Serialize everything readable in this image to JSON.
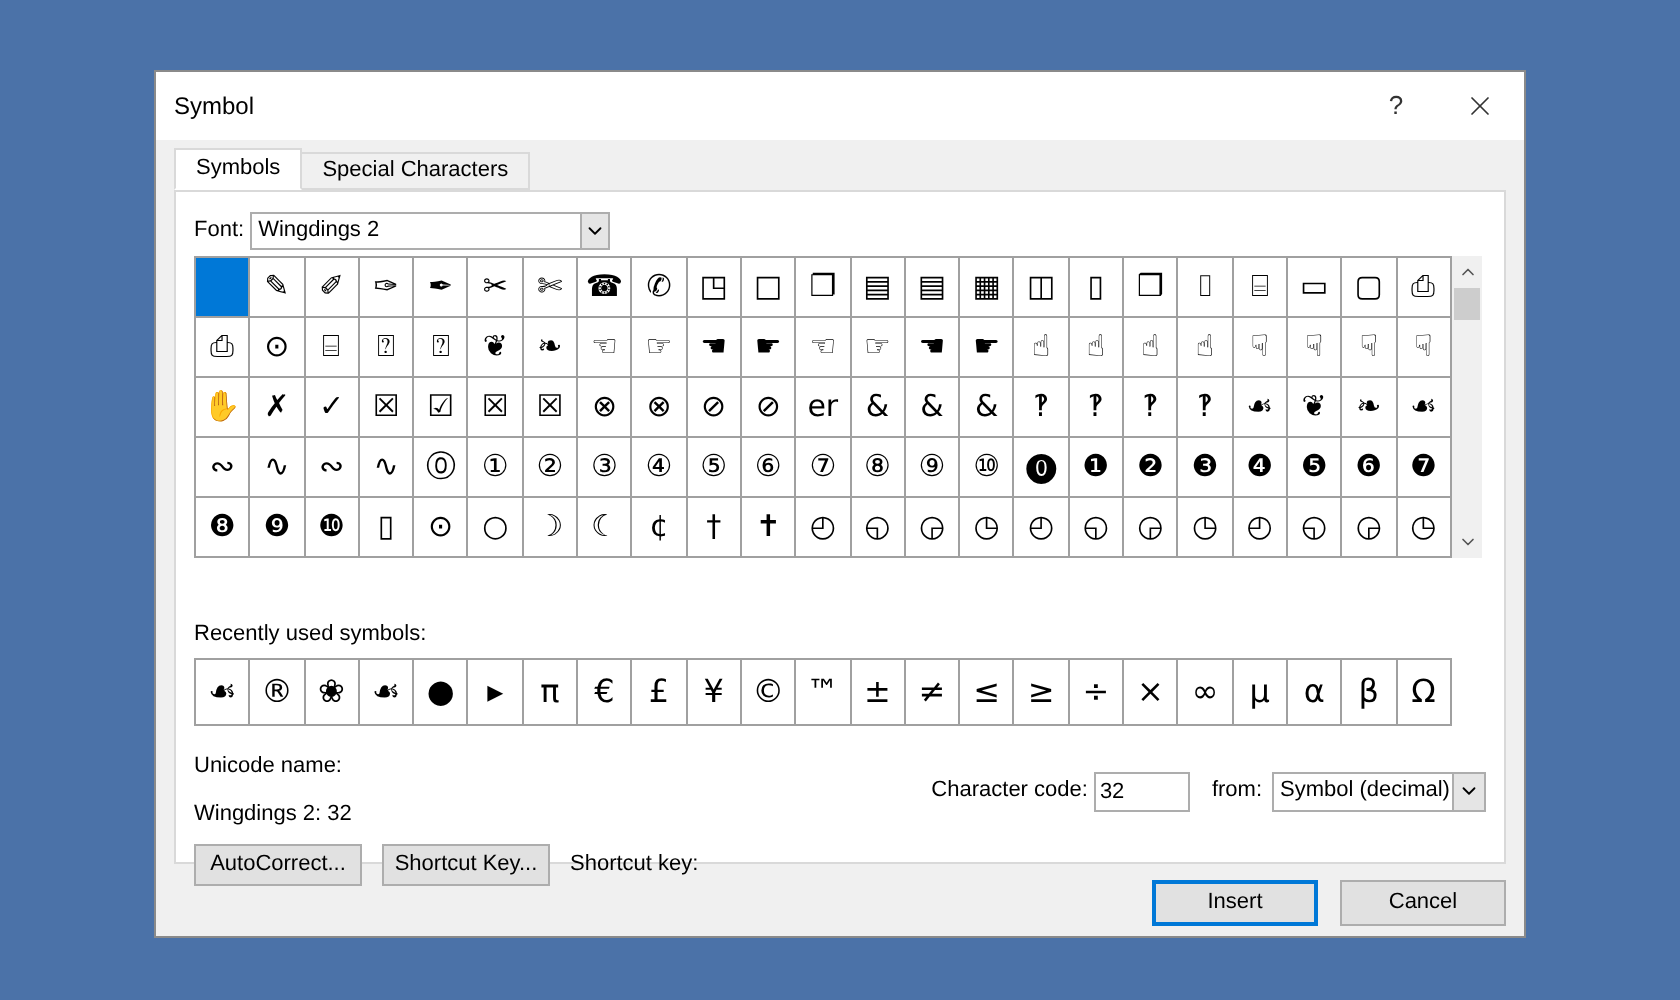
{
  "window": {
    "title": "Symbol",
    "help": "?"
  },
  "tabs": [
    {
      "label": "Symbols",
      "selected": true
    },
    {
      "label": "Special Characters",
      "selected": false
    }
  ],
  "font": {
    "label": "Font:",
    "value": "Wingdings 2"
  },
  "symbols": [
    [
      {
        "selected": true
      },
      {
        "glyph": "✎",
        "selected": false
      },
      {
        "glyph": "✐",
        "selected": false
      },
      {
        "glyph": "✑",
        "selected": false
      },
      {
        "glyph": "✒",
        "selected": false
      },
      {
        "glyph": "✂",
        "selected": false
      },
      {
        "glyph": "✄",
        "selected": false
      },
      {
        "glyph": "☎",
        "selected": false
      },
      {
        "glyph": "✆",
        "selected": false
      },
      {
        "glyph": "◳",
        "selected": false
      },
      {
        "glyph": "□",
        "selected": false
      },
      {
        "glyph": "❐",
        "selected": false
      },
      {
        "glyph": "▤",
        "selected": false
      },
      {
        "glyph": "▤",
        "selected": false
      },
      {
        "glyph": "▦",
        "selected": false
      },
      {
        "glyph": "◫",
        "selected": false
      },
      {
        "glyph": "▯",
        "selected": false
      },
      {
        "glyph": "❒",
        "selected": false
      },
      {
        "glyph": "⌷",
        "selected": false
      },
      {
        "glyph": "⌸",
        "selected": false
      },
      {
        "glyph": "▭",
        "selected": false
      },
      {
        "glyph": "▢",
        "selected": false
      },
      {
        "glyph": "⎙",
        "selected": false
      }
    ],
    [
      {
        "glyph": "⎙",
        "selected": false
      },
      {
        "glyph": "⊙",
        "selected": false
      },
      {
        "glyph": "⌸",
        "selected": false
      },
      {
        "glyph": "⍰",
        "selected": false
      },
      {
        "glyph": "⍰",
        "selected": false
      },
      {
        "glyph": "❦",
        "selected": false
      },
      {
        "glyph": "❧",
        "selected": false
      },
      {
        "glyph": "☜",
        "selected": false
      },
      {
        "glyph": "☞",
        "selected": false
      },
      {
        "glyph": "☚",
        "selected": false
      },
      {
        "glyph": "☛",
        "selected": false
      },
      {
        "glyph": "☜",
        "selected": false
      },
      {
        "glyph": "☞",
        "selected": false
      },
      {
        "glyph": "☚",
        "selected": false
      },
      {
        "glyph": "☛",
        "selected": false
      },
      {
        "glyph": "☝",
        "selected": false
      },
      {
        "glyph": "☝",
        "selected": false
      },
      {
        "glyph": "☝",
        "selected": false
      },
      {
        "glyph": "☝",
        "selected": false
      },
      {
        "glyph": "☟",
        "selected": false
      },
      {
        "glyph": "☟",
        "selected": false
      },
      {
        "glyph": "☟",
        "selected": false
      },
      {
        "glyph": "☟",
        "selected": false
      }
    ],
    [
      {
        "glyph": "✋",
        "selected": false
      },
      {
        "glyph": "✗",
        "selected": false
      },
      {
        "glyph": "✓",
        "selected": false
      },
      {
        "glyph": "☒",
        "selected": false
      },
      {
        "glyph": "☑",
        "selected": false
      },
      {
        "glyph": "☒",
        "selected": false
      },
      {
        "glyph": "☒",
        "selected": false
      },
      {
        "glyph": "⊗",
        "selected": false
      },
      {
        "glyph": "⊗",
        "selected": false
      },
      {
        "glyph": "⊘",
        "selected": false
      },
      {
        "glyph": "⊘",
        "selected": false
      },
      {
        "glyph": "er",
        "selected": false
      },
      {
        "glyph": "&",
        "selected": false
      },
      {
        "glyph": "&",
        "selected": false
      },
      {
        "glyph": "&",
        "selected": false
      },
      {
        "glyph": "‽",
        "selected": false
      },
      {
        "glyph": "‽",
        "selected": false
      },
      {
        "glyph": "‽",
        "selected": false
      },
      {
        "glyph": "‽",
        "selected": false
      },
      {
        "glyph": "☙",
        "selected": false
      },
      {
        "glyph": "❦",
        "selected": false
      },
      {
        "glyph": "❧",
        "selected": false
      },
      {
        "glyph": "☙",
        "selected": false
      }
    ],
    [
      {
        "glyph": "∾",
        "selected": false
      },
      {
        "glyph": "∿",
        "selected": false
      },
      {
        "glyph": "∾",
        "selected": false
      },
      {
        "glyph": "∿",
        "selected": false
      },
      {
        "glyph": "⓪",
        "selected": false
      },
      {
        "glyph": "①",
        "selected": false
      },
      {
        "glyph": "②",
        "selected": false
      },
      {
        "glyph": "③",
        "selected": false
      },
      {
        "glyph": "④",
        "selected": false
      },
      {
        "glyph": "⑤",
        "selected": false
      },
      {
        "glyph": "⑥",
        "selected": false
      },
      {
        "glyph": "⑦",
        "selected": false
      },
      {
        "glyph": "⑧",
        "selected": false
      },
      {
        "glyph": "⑨",
        "selected": false
      },
      {
        "glyph": "⑩",
        "selected": false
      },
      {
        "glyph": "⓿",
        "selected": false
      },
      {
        "glyph": "❶",
        "selected": false
      },
      {
        "glyph": "❷",
        "selected": false
      },
      {
        "glyph": "❸",
        "selected": false
      },
      {
        "glyph": "❹",
        "selected": false
      },
      {
        "glyph": "❺",
        "selected": false
      },
      {
        "glyph": "❻",
        "selected": false
      },
      {
        "glyph": "❼",
        "selected": false
      }
    ],
    [
      {
        "glyph": "❽",
        "selected": false
      },
      {
        "glyph": "❾",
        "selected": false
      },
      {
        "glyph": "❿",
        "selected": false
      },
      {
        "glyph": "▯",
        "selected": false
      },
      {
        "glyph": "⊙",
        "selected": false
      },
      {
        "glyph": "○",
        "selected": false
      },
      {
        "glyph": "☽",
        "selected": false
      },
      {
        "glyph": "☾",
        "selected": false
      },
      {
        "glyph": "¢",
        "selected": false
      },
      {
        "glyph": "†",
        "selected": false
      },
      {
        "glyph": "✝",
        "selected": false
      },
      {
        "glyph": "◴",
        "selected": false
      },
      {
        "glyph": "◵",
        "selected": false
      },
      {
        "glyph": "◶",
        "selected": false
      },
      {
        "glyph": "◷",
        "selected": false
      },
      {
        "glyph": "◴",
        "selected": false
      },
      {
        "glyph": "◵",
        "selected": false
      },
      {
        "glyph": "◶",
        "selected": false
      },
      {
        "glyph": "◷",
        "selected": false
      },
      {
        "glyph": "◴",
        "selected": false
      },
      {
        "glyph": "◵",
        "selected": false
      },
      {
        "glyph": "◶",
        "selected": false
      },
      {
        "glyph": "◷",
        "selected": false
      }
    ]
  ],
  "recent": {
    "label": "Recently used symbols:",
    "symbols": [
      "☙",
      "®",
      "❀",
      "☙",
      "●",
      "▸",
      "π",
      "€",
      "£",
      "¥",
      "©",
      "™",
      "±",
      "≠",
      "≤",
      "≥",
      "÷",
      "×",
      "∞",
      "µ",
      "α",
      "β",
      "Ω"
    ]
  },
  "unicode_name": {
    "label": "Unicode name:",
    "value": "Wingdings 2: 32"
  },
  "character_code": {
    "label": "Character code:",
    "value": "32"
  },
  "from": {
    "label": "from:",
    "value": "Symbol (decimal)"
  },
  "autocorrect_button": "AutoCorrect...",
  "shortcut_key_button": "Shortcut Key...",
  "shortcut_key_label": "Shortcut key:",
  "insert_button": "Insert",
  "cancel_button": "Cancel"
}
